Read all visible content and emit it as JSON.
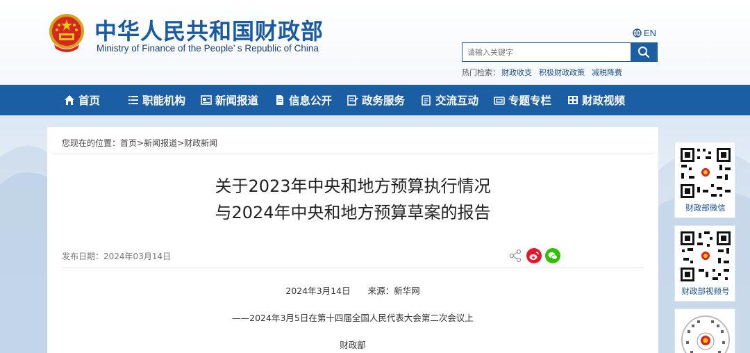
{
  "header": {
    "title": "中华人民共和国财政部",
    "subtitle": "Ministry of Finance of the People’ s Republic of China",
    "lang_label": "EN",
    "search_placeholder": "请输入关键字",
    "hot_label": "热门检索：",
    "hot_items": [
      "财政收支",
      "积极财政政策",
      "减税降费"
    ]
  },
  "nav": {
    "items": [
      {
        "label": "首页",
        "icon": "home-icon"
      },
      {
        "label": "职能机构",
        "icon": "list-icon"
      },
      {
        "label": "新闻报道",
        "icon": "news-icon"
      },
      {
        "label": "信息公开",
        "icon": "document-icon"
      },
      {
        "label": "政务服务",
        "icon": "service-icon"
      },
      {
        "label": "交流互动",
        "icon": "chat-icon"
      },
      {
        "label": "专题专栏",
        "icon": "folder-icon"
      },
      {
        "label": "财政视频",
        "icon": "video-icon"
      }
    ]
  },
  "breadcrumb": {
    "prefix": "您现在的位置：",
    "items": [
      "首页",
      "新闻报道",
      "财政新闻"
    ],
    "separator": ">"
  },
  "article": {
    "title_line1": "关于2023年中央和地方预算执行情况",
    "title_line2": "与2024年中央和地方预算草案的报告",
    "publish_label": "发布日期：",
    "publish_date": "2024年03月14日",
    "date_source": "2024年3月14日　　来源：新华网",
    "subheading": "——2024年3月5日在第十四届全国人民代表大会第二次会议上",
    "author": "财政部"
  },
  "sidebar": {
    "qr_cards": [
      {
        "label": "财政部微信"
      },
      {
        "label": "财政部视频号"
      },
      {
        "label": ""
      }
    ]
  },
  "colors": {
    "brand_blue": "#1c5ea3",
    "weibo_red": "#e6162d",
    "wechat_green": "#2dc100"
  }
}
